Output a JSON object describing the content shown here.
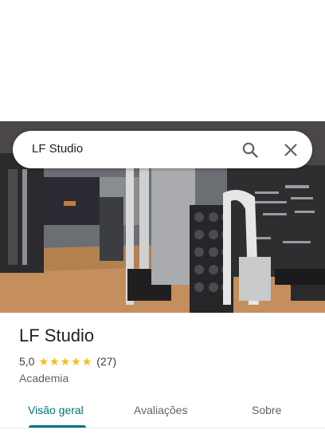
{
  "search": {
    "query": "LF Studio"
  },
  "place": {
    "name": "LF Studio",
    "rating": "5,0",
    "stars": 5,
    "review_count": "(27)",
    "category": "Academia"
  },
  "tabs": [
    {
      "label": "Visão geral",
      "active": true
    },
    {
      "label": "Avaliações",
      "active": false
    },
    {
      "label": "Sobre",
      "active": false
    }
  ],
  "colors": {
    "accent": "#00737a",
    "star": "#fbbc04"
  },
  "icons": {
    "search": "search-icon",
    "close": "close-icon"
  }
}
